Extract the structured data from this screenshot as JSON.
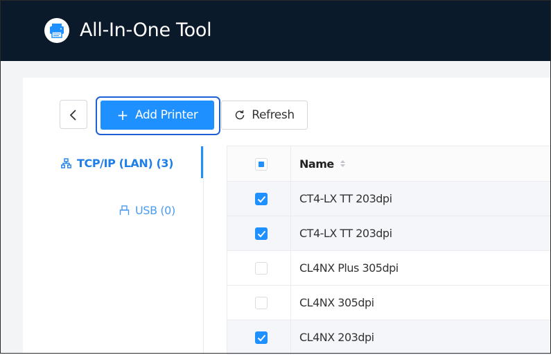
{
  "app": {
    "title": "All-In-One Tool",
    "logo_icon": "printer-icon"
  },
  "toolbar": {
    "back_icon": "chevron-left-icon",
    "add_label": "Add Printer",
    "add_icon": "plus-icon",
    "refresh_label": "Refresh",
    "refresh_icon": "refresh-icon"
  },
  "sidebar": {
    "items": [
      {
        "label": "TCP/IP (LAN) (3)",
        "icon": "network-icon",
        "active": true
      },
      {
        "label": "USB (0)",
        "icon": "usb-icon",
        "active": false
      }
    ]
  },
  "table": {
    "header": {
      "name": "Name",
      "select_all_state": "indeterminate",
      "sort_icon": "sort-icon"
    },
    "rows": [
      {
        "name": "CT4-LX TT 203dpi",
        "checked": true
      },
      {
        "name": "CT4-LX TT 203dpi",
        "checked": true
      },
      {
        "name": "CL4NX Plus 305dpi",
        "checked": false
      },
      {
        "name": "CL4NX 305dpi",
        "checked": false
      },
      {
        "name": "CL4NX 203dpi",
        "checked": true
      }
    ]
  },
  "colors": {
    "header_bg": "#0b1a2b",
    "accent": "#1e90ff",
    "focus_ring": "#1f5fd6"
  }
}
